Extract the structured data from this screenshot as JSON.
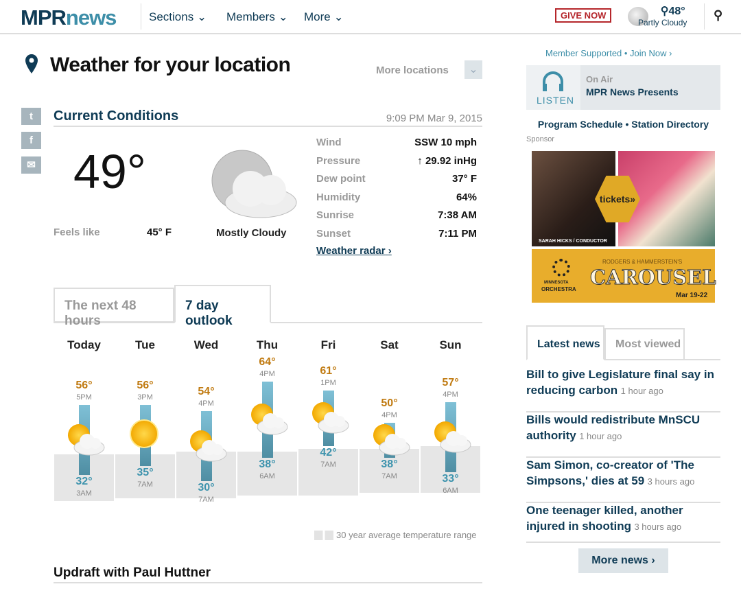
{
  "header": {
    "logo_a": "MPR",
    "logo_b": "news",
    "nav": [
      "Sections",
      "Members",
      "More"
    ],
    "give": "GIVE NOW",
    "weather_temp": "48°",
    "weather_cond": "Partly Cloudy"
  },
  "page": {
    "title": "Weather for your location",
    "more_locations": "More locations"
  },
  "current": {
    "heading": "Current Conditions",
    "timestamp": "9:09 PM Mar 9, 2015",
    "temp": "49°",
    "feels_like_label": "Feels like",
    "feels_like": "45° F",
    "condition": "Mostly Cloudy",
    "details": [
      {
        "label": "Wind",
        "value": "SSW 10 mph"
      },
      {
        "label": "Pressure",
        "value": "↑ 29.92 inHg"
      },
      {
        "label": "Dew point",
        "value": "37° F"
      },
      {
        "label": "Humidity",
        "value": "64%"
      },
      {
        "label": "Sunrise",
        "value": "7:38 AM"
      },
      {
        "label": "Sunset",
        "value": "7:11 PM"
      }
    ],
    "radar_link": "Weather radar"
  },
  "tabs": [
    "The next 48 hours",
    "7 day outlook"
  ],
  "chart_data": {
    "type": "bar",
    "categories": [
      "Today",
      "Tue",
      "Wed",
      "Thu",
      "Fri",
      "Sat",
      "Sun"
    ],
    "series": [
      {
        "name": "high",
        "values": [
          56,
          56,
          54,
          64,
          61,
          50,
          57
        ],
        "times": [
          "5PM",
          "3PM",
          "4PM",
          "4PM",
          "1PM",
          "4PM",
          "4PM"
        ]
      },
      {
        "name": "low",
        "values": [
          32,
          35,
          30,
          38,
          42,
          38,
          33
        ],
        "times": [
          "3AM",
          "7AM",
          "7AM",
          "6AM",
          "7AM",
          "7AM",
          "6AM"
        ]
      }
    ],
    "average_range": {
      "highs": [
        39,
        39,
        40,
        40,
        41,
        41,
        42
      ],
      "lows": [
        23,
        24,
        24,
        25,
        25,
        26,
        26
      ]
    },
    "icons": [
      "partly-cloudy",
      "sunny",
      "partly-cloudy",
      "partly-cloudy",
      "partly-cloudy",
      "partly-cloudy",
      "partly-cloudy"
    ],
    "legend": "30 year average temperature range"
  },
  "updraft": "Updraft with Paul Huttner",
  "sidebar": {
    "member": "Member Supported • Join Now",
    "listen": "LISTEN",
    "on_air": "On Air",
    "program": "MPR News Presents",
    "schedule": "Program Schedule • Station Directory",
    "sponsor": "Sponsor",
    "ad": {
      "tickets": "tickets»",
      "caption": "SARAH HICKS / CONDUCTOR",
      "org1": "MINNESOTA",
      "org2": "ORCHESTRA",
      "pre": "RODGERS & HAMMERSTEIN'S",
      "show": "CAROUSEL",
      "dates": "Mar 19-22"
    },
    "news_tabs": [
      "Latest news",
      "Most viewed"
    ],
    "news": [
      {
        "title": "Bill to give Legislature final say in reducing carbon",
        "ago": "1 hour ago"
      },
      {
        "title": "Bills would redistribute MnSCU authority",
        "ago": "1 hour ago"
      },
      {
        "title": "Sam Simon, co-creator of 'The Simpsons,' dies at 59",
        "ago": "3 hours ago"
      },
      {
        "title": "One teenager killed, another injured in shooting",
        "ago": "3 hours ago"
      }
    ],
    "more_news": "More news"
  },
  "colors": {
    "navy": "#0f3b55",
    "teal": "#3d8ea8",
    "high": "#c07a10",
    "low": "#3d93ad"
  }
}
